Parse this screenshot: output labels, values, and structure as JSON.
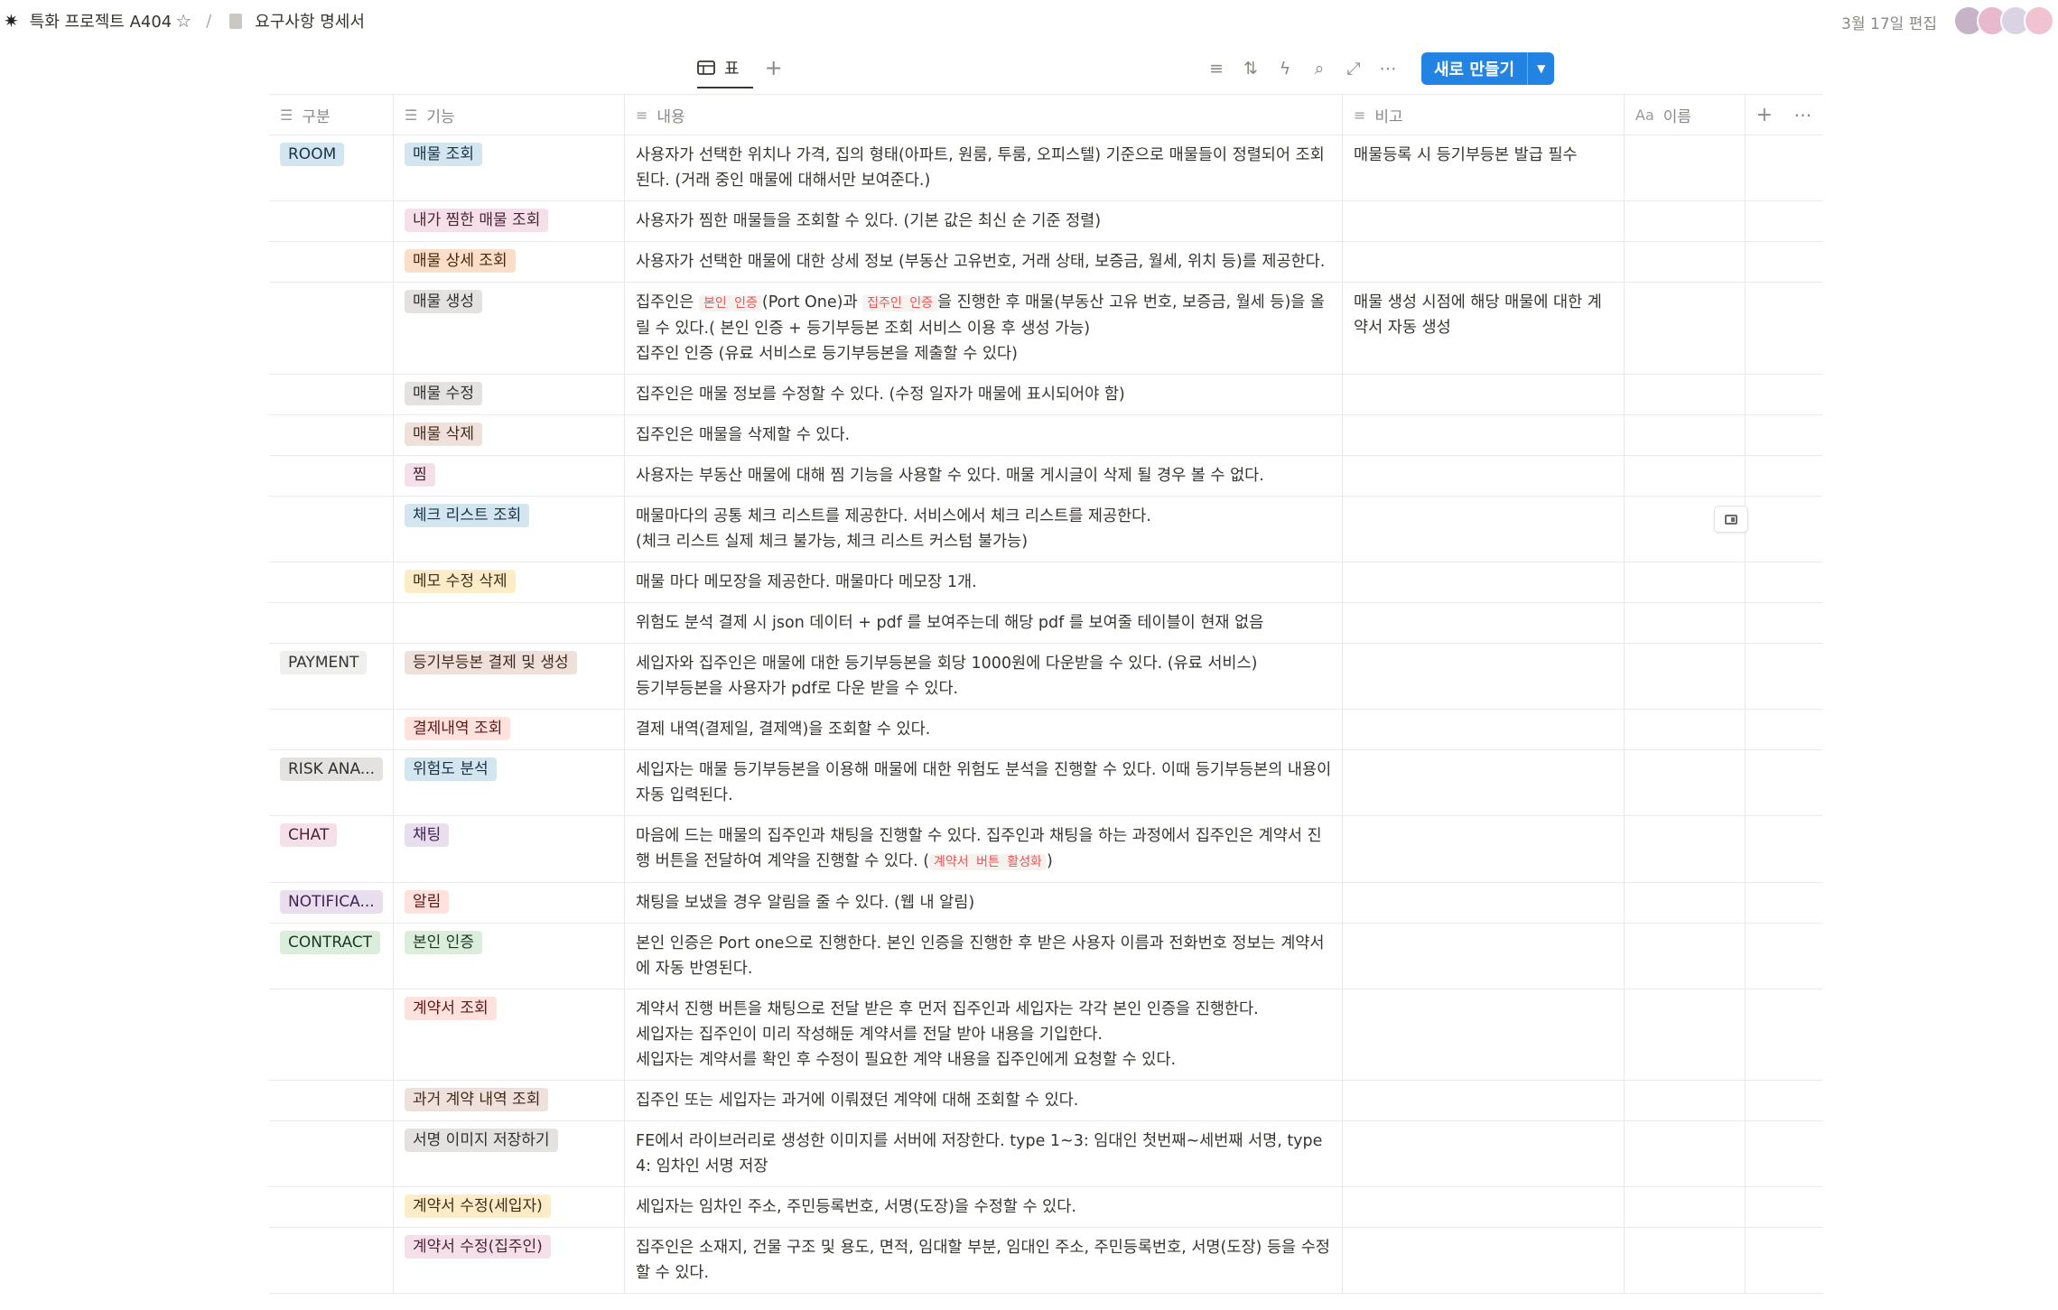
{
  "breadcrumb": {
    "workspace": "특화 프로젝트 A404",
    "page": "요구사항 명세서"
  },
  "edited": "3월 17일 편집",
  "view": {
    "tab_label": "표",
    "new_button": "새로 만들기"
  },
  "columns": [
    "구분",
    "기능",
    "내용",
    "비고",
    "이름"
  ],
  "colors": {
    "accent": "#2383e2",
    "border": "#e9e9e7",
    "code_text": "#eb5757"
  },
  "rows": [
    {
      "cat": "ROOM",
      "cat_color": "blue",
      "feat": "매물 조회",
      "feat_color": "blue",
      "content": [
        "사용자가 선택한 위치나 가격, 집의 형태(아파트, 원룸, 투룸, 오피스텔) 기준으로 매물들이 정렬되어 조회된다. (거래 중인 매물에 대해서만 보여준다.)"
      ],
      "note": "매물등록 시 등기부등본 발급 필수"
    },
    {
      "cat": "",
      "feat": "내가 찜한 매물 조회",
      "feat_color": "pink",
      "content": [
        "사용자가 찜한 매물들을 조회할 수 있다. (기본 값은 최신 순 기준 정렬)"
      ],
      "note": ""
    },
    {
      "cat": "",
      "feat": "매물 상세 조회",
      "feat_color": "orange",
      "content": [
        "사용자가 선택한 매물에 대한 상세 정보 (부동산 고유번호, 거래 상태, 보증금, 월세, 위치 등)를 제공한다."
      ],
      "note": ""
    },
    {
      "cat": "",
      "feat": "매물 생성",
      "feat_color": "gray",
      "content_rich": {
        "p1": "집주인은 ",
        "code1": "본인 인증",
        "p2": "(Port One)과 ",
        "code2": "집주인 인증",
        "p3": "을 진행한 후 매물(부동산 고유 번호, 보증금, 월세 등)을 올릴 수 있다.( 본인 인증 + 등기부등본 조회 서비스 이용 후 생성 가능)",
        "line2": "집주인 인증 (유료 서비스로 등기부등본을 제출할 수 있다)"
      },
      "note": "매물  생성 시점에 해당 매물에 대한 계약서 자동 생성"
    },
    {
      "cat": "",
      "feat": "매물 수정",
      "feat_color": "gray",
      "content": [
        "집주인은 매물 정보를 수정할 수 있다. (수정 일자가 매물에 표시되어야 함)"
      ],
      "note": ""
    },
    {
      "cat": "",
      "feat": "매물 삭제",
      "feat_color": "brown",
      "content": [
        "집주인은 매물을 삭제할 수 있다."
      ],
      "note": ""
    },
    {
      "cat": "",
      "feat": "찜",
      "feat_color": "pink",
      "content": [
        "사용자는 부동산 매물에 대해 찜 기능을 사용할 수 있다. 매물 게시글이 삭제 될 경우 볼 수 없다."
      ],
      "note": ""
    },
    {
      "cat": "",
      "feat": "체크 리스트 조회",
      "feat_color": "blue",
      "content": [
        "매물마다의 공통 체크 리스트를 제공한다. 서비스에서 체크 리스트를 제공한다.",
        "(체크 리스트 실제 체크 불가능, 체크 리스트 커스텀 불가능)"
      ],
      "note": "",
      "side_icon": "open-as-page-icon"
    },
    {
      "cat": "",
      "feat": "메모 수정 삭제",
      "feat_color": "yellow",
      "content": [
        "매물 마다 메모장을 제공한다. 매물마다 메모장 1개."
      ],
      "note": ""
    },
    {
      "cat": "",
      "feat": "",
      "content": [
        "위험도 분석 결제 시 json 데이터 + pdf 를 보여주는데 해당 pdf 를 보여줄 테이블이 현재 없음"
      ],
      "note": ""
    },
    {
      "cat": "PAYMENT",
      "cat_color": "default",
      "feat": "등기부등본 결제 및 생성",
      "feat_color": "brown",
      "content": [
        "세입자와 집주인은 매물에 대한 등기부등본을 회당 1000원에 다운받을 수 있다. (유료 서비스)",
        "등기부등본을 사용자가 pdf로 다운 받을 수 있다."
      ],
      "note": ""
    },
    {
      "cat": "",
      "feat": "결제내역 조회",
      "feat_color": "red",
      "content": [
        "결제 내역(결제일, 결제액)을 조회할 수 있다."
      ],
      "note": ""
    },
    {
      "cat": "RISK ANA...",
      "cat_color": "gray",
      "feat": "위험도 분석",
      "feat_color": "blue",
      "content": [
        "세입자는 매물 등기부등본을 이용해 매물에 대한 위험도 분석을 진행할 수 있다. 이때 등기부등본의 내용이 자동 입력된다."
      ],
      "note": ""
    },
    {
      "cat": "CHAT",
      "cat_color": "pink",
      "feat": "채팅",
      "feat_color": "purple",
      "content_rich2": {
        "p1": "마음에 드는 매물의 집주인과 채팅을 진행할 수 있다. 집주인과 채팅을 하는 과정에서 집주인은 계약서 진행 버튼을 전달하여 계약을 진행할 수 있다. (",
        "code": "계약서 버튼 활성화",
        "p2": ")"
      },
      "note": ""
    },
    {
      "cat": "NOTIFICA...",
      "cat_color": "purple",
      "feat": "알림",
      "feat_color": "red",
      "content": [
        "채팅을 보냈을 경우 알림을 줄 수 있다. (웹 내 알림)"
      ],
      "note": ""
    },
    {
      "cat": "CONTRACT",
      "cat_color": "green",
      "feat": "본인 인증",
      "feat_color": "green",
      "content": [
        "본인 인증은 Port one으로 진행한다. 본인 인증을 진행한 후 받은 사용자 이름과 전화번호 정보는 계약서에 자동 반영된다."
      ],
      "note": ""
    },
    {
      "cat": "",
      "feat": "계약서 조회",
      "feat_color": "red",
      "content": [
        "계약서 진행 버튼을 채팅으로 전달 받은 후 먼저 집주인과 세입자는 각각 본인 인증을 진행한다.",
        "세입자는 집주인이 미리 작성해둔 계약서를 전달 받아 내용을 기입한다.",
        "세입자는 계약서를 확인 후 수정이 필요한 계약 내용을 집주인에게 요청할 수 있다."
      ],
      "note": ""
    },
    {
      "cat": "",
      "feat": "과거 계약 내역 조회",
      "feat_color": "brown",
      "content": [
        "집주인 또는 세입자는 과거에 이뤄졌던 계약에 대해 조회할 수 있다."
      ],
      "note": ""
    },
    {
      "cat": "",
      "feat": "서명 이미지 저장하기",
      "feat_color": "gray",
      "content": [
        "FE에서 라이브러리로 생성한 이미지를 서버에 저장한다. type 1~3: 임대인 첫번째~세번째 서명, type 4: 임차인 서명 저장"
      ],
      "note": ""
    },
    {
      "cat": "",
      "feat": "계약서 수정(세입자)",
      "feat_color": "yellow",
      "content": [
        "세입자는 임차인 주소, 주민등록번호, 서명(도장)을 수정할 수 있다."
      ],
      "note": ""
    },
    {
      "cat": "",
      "feat": "계약서 수정(집주인)",
      "feat_color": "pink",
      "content": [
        "집주인은 소재지, 건물 구조 및 용도, 면적, 임대할 부분, 임대인 주소, 주민등록번호, 서명(도장) 등을 수정할 수 있다."
      ],
      "note": ""
    }
  ]
}
